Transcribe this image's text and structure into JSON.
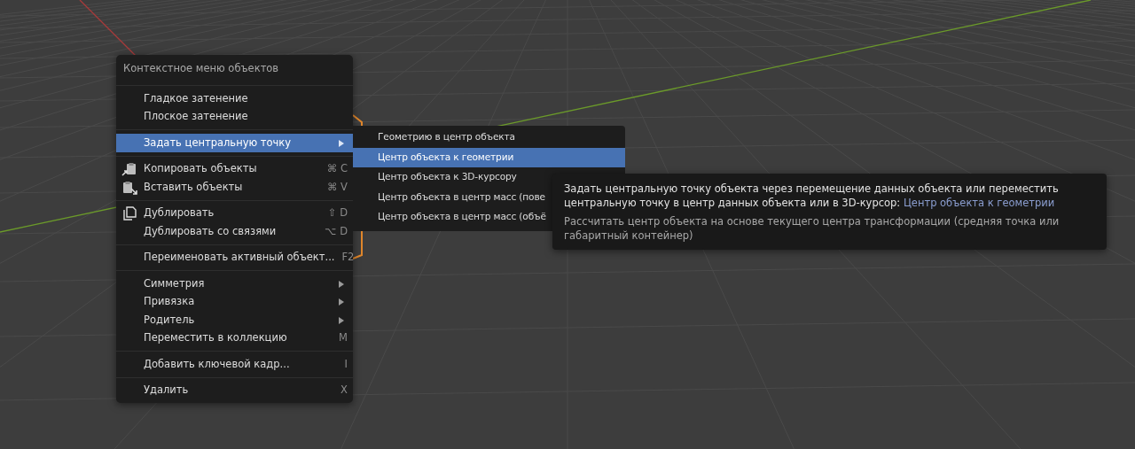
{
  "context_menu": {
    "title": "Контекстное меню объектов",
    "items": [
      {
        "kind": "separator"
      },
      {
        "kind": "item",
        "label": "Гладкое затенение",
        "selected": false
      },
      {
        "kind": "item",
        "label": "Плоское затенение",
        "selected": false
      },
      {
        "kind": "separator"
      },
      {
        "kind": "submenu",
        "label": "Задать центральную точку",
        "selected": true
      },
      {
        "kind": "separator"
      },
      {
        "kind": "item",
        "label": "Копировать объекты",
        "shortcut": "⌘ C",
        "selected": false
      },
      {
        "kind": "item",
        "label": "Вставить объекты",
        "shortcut": "⌘ V",
        "selected": false
      },
      {
        "kind": "separator"
      },
      {
        "kind": "item",
        "label": "Дублировать",
        "shortcut": "⇧ D",
        "selected": false
      },
      {
        "kind": "item",
        "label": "Дублировать со связями",
        "shortcut": "⌥ D",
        "selected": false
      },
      {
        "kind": "separator"
      },
      {
        "kind": "item",
        "label": "Переименовать активный объект...",
        "shortcut": "F2",
        "selected": false
      },
      {
        "kind": "separator"
      },
      {
        "kind": "submenu",
        "label": "Симметрия",
        "selected": false
      },
      {
        "kind": "submenu",
        "label": "Привязка",
        "selected": false
      },
      {
        "kind": "submenu",
        "label": "Родитель",
        "selected": false
      },
      {
        "kind": "item",
        "label": "Переместить в коллекцию",
        "shortcut": "M",
        "selected": false
      },
      {
        "kind": "separator"
      },
      {
        "kind": "item",
        "label": "Добавить ключевой кадр...",
        "shortcut": "I",
        "selected": false
      },
      {
        "kind": "separator"
      },
      {
        "kind": "item",
        "label": "Удалить",
        "shortcut": "X",
        "selected": false
      }
    ]
  },
  "submenu": {
    "items": [
      {
        "label": "Геометрию в центр объекта",
        "selected": false
      },
      {
        "label": "Центр объекта к геометрии",
        "selected": true
      },
      {
        "label": "Центр объекта к 3D-курсору",
        "selected": false
      },
      {
        "label": "Центр объекта в центр масс (пове",
        "selected": false
      },
      {
        "label": "Центр объекта в центр масс (объё",
        "selected": false
      }
    ]
  },
  "tooltip": {
    "description": "Задать центральную точку объекта через перемещение данных объекта или переместить центральную точку в центр данных объекта или в 3D-курсор:",
    "operator": "Центр объекта к геометрии",
    "detail": "Рассчитать центр объекта на основе текущего центра трансформации (средняя точка или габаритный контейнер)"
  }
}
